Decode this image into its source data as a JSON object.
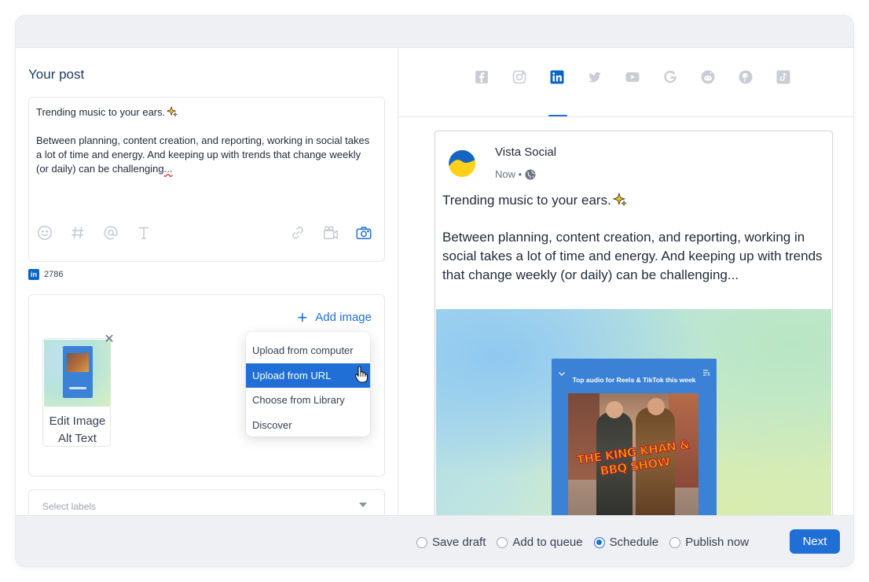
{
  "composer": {
    "title": "Your post",
    "post_text_line1": "Trending music to your ears.",
    "post_text_body_a": "Between planning, content creation, and reporting, working in social takes a lot of time and energy. And keeping up with trends that change weekly (or daily) can be challenging",
    "post_text_body_b": "...",
    "toolbar_icons": [
      "emoji-icon",
      "hashtag-icon",
      "mention-icon",
      "text-format-icon",
      "link-icon",
      "video-icon",
      "camera-icon"
    ],
    "char_count": "2786",
    "char_count_network": "linkedin-icon"
  },
  "media": {
    "add_image_label": "Add image",
    "thumbnail": {
      "label_line1": "Edit Image",
      "label_line2": "Alt Text"
    },
    "dropdown": {
      "items": [
        "Upload from computer",
        "Upload from URL",
        "Choose from Library",
        "Discover"
      ],
      "active_index": 1
    }
  },
  "labels": {
    "placeholder": "Select labels"
  },
  "preview": {
    "networks": [
      "facebook-icon",
      "instagram-icon",
      "linkedin-icon",
      "twitter-icon",
      "youtube-icon",
      "google-icon",
      "reddit-icon",
      "pinterest-icon",
      "tiktok-icon"
    ],
    "active_network": "linkedin-icon",
    "account_name": "Vista Social",
    "meta": "Now •",
    "text_line1": "Trending music to your ears.",
    "text_body": "Between planning, content creation, and reporting, working in social takes a lot of time and energy. And keeping up with trends that change weekly (or daily) can be challenging...",
    "phone_header": "Top audio for Reels & TikTok this week",
    "album_title": "THE KING KHAN & BBQ SHOW"
  },
  "footer": {
    "options": [
      {
        "label": "Save draft",
        "checked": false
      },
      {
        "label": "Add to queue",
        "checked": false
      },
      {
        "label": "Schedule",
        "checked": true
      },
      {
        "label": "Publish now",
        "checked": false
      }
    ],
    "next_label": "Next"
  },
  "colors": {
    "accent": "#1f6fd6",
    "linkedin": "#0a66c2",
    "icon_muted": "#c3c8d0"
  }
}
